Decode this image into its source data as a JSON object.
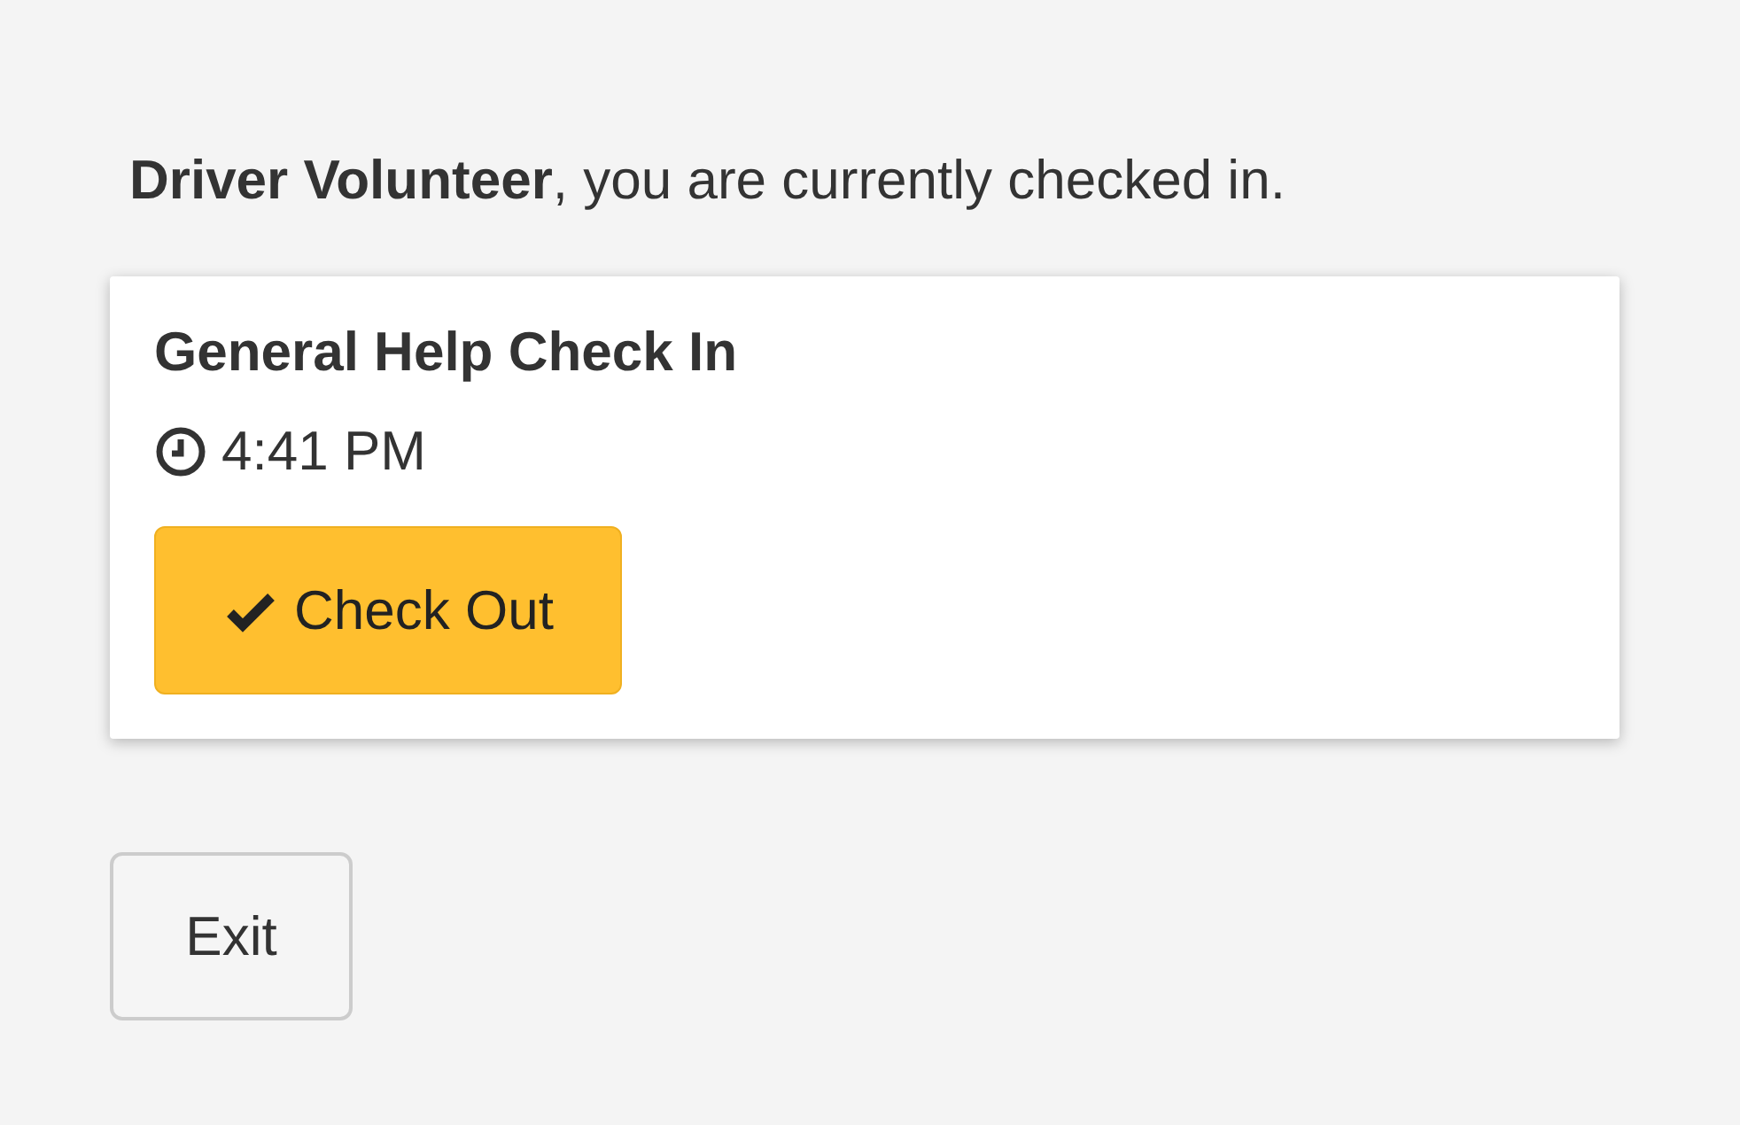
{
  "status_message": "**Driver Volunteer**, you are currently checked in.",
  "checkin": {
    "title": "General Help Check In",
    "time": "4:41 PM",
    "button": "Check Out"
  },
  "exit_button": "Exit"
}
